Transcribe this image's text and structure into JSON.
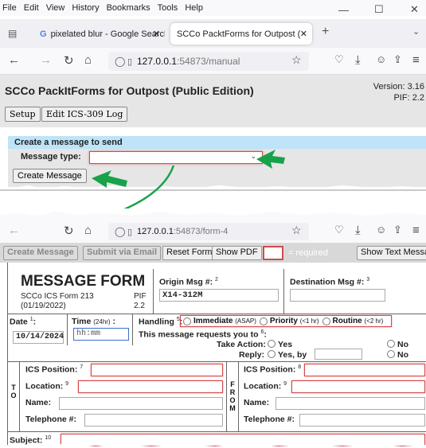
{
  "browser": {
    "menu": [
      "File",
      "Edit",
      "View",
      "History",
      "Bookmarks",
      "Tools",
      "Help"
    ],
    "tabs": [
      {
        "title": "pixelated blur - Google Search",
        "active": false
      },
      {
        "title": "SCCo PacktForms for Outpost (Publ",
        "active": true
      }
    ],
    "url1_host": "127.0.0.1",
    "url1_path": ":54873/manual",
    "url2_host": "127.0.0.1",
    "url2_path": ":54873/form-4"
  },
  "manual_page": {
    "title": "SCCo PackItForms for Outpost (Public Edition)",
    "version_line1": "Version: 3.16",
    "version_line2": "PIF: 2.2",
    "setup_label": "Setup",
    "edit_log_label": "Edit ICS-309 Log",
    "create_header": "Create a message to send",
    "message_type_label": "Message type:",
    "message_type_value": "",
    "create_message_label": "Create Message"
  },
  "form_toolbar": {
    "create_message": "Create Message",
    "submit_email": "Submit via Email",
    "reset_form": "Reset Form",
    "show_pdf": "Show PDF",
    "required_text": "= required",
    "show_text_message": "Show Text Message"
  },
  "form": {
    "title": "MESSAGE FORM",
    "subtitle1": "SCCo ICS Form 213",
    "subtitle2": "(01/19/2022)",
    "pif_label": "PIF",
    "pif_value": "2.2",
    "origin_label": "Origin Msg #:",
    "origin_sup": "2",
    "origin_value": "X14-312M",
    "dest_label": "Destination Msg #:",
    "dest_sup": "3",
    "date_label": "Date",
    "date_sup": "1",
    "date_value": "10/14/2024",
    "time_label": "Time",
    "time_unit": "(24hr)",
    "time_placeholder": "hh:mm",
    "handling_label": "Handling",
    "handling_sup": "5",
    "handling_options": [
      {
        "label": "Immediate",
        "note": "(ASAP)"
      },
      {
        "label": "Priority",
        "note": "(<1 hr)"
      },
      {
        "label": "Routine",
        "note": "(<2 hr)"
      }
    ],
    "requests_label": "This message requests you to",
    "requests_sup": "6",
    "take_action_label": "Take Action:",
    "reply_label": "Reply:",
    "yes_label": "Yes",
    "yes_by_label": "Yes, by",
    "no_label": "No",
    "to_letters": [
      "T",
      "O"
    ],
    "from_letters": [
      "F",
      "R",
      "O",
      "M"
    ],
    "ics_position_label": "ICS Position:",
    "to_pos_sup": "7",
    "from_pos_sup": "8",
    "location_label": "Location:",
    "to_loc_sup": "9",
    "from_loc_sup": "9",
    "name_label": "Name:",
    "telephone_label": "Telephone #:",
    "subject_label": "Subject:",
    "subject_sup": "10"
  },
  "colors": {
    "required_border": "#d04a4a",
    "header_blue": "#bde4f8",
    "arrow_green": "#18a24a"
  }
}
